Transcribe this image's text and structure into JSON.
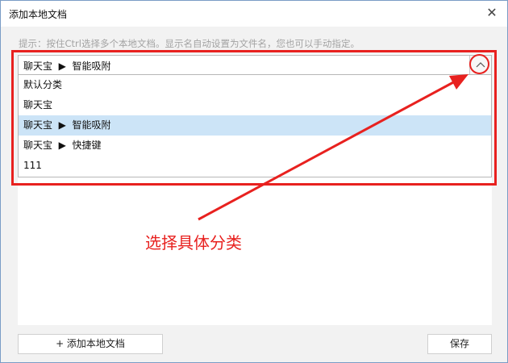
{
  "window": {
    "title": "添加本地文档",
    "close_icon": "close-icon"
  },
  "hint": "提示：按住Ctrl选择多个本地文档。显示名自动设置为文件名，您也可以手动指定。",
  "category_select": {
    "selected": "聊天宝  ▶  智能吸附",
    "toggle_icon": "chevron-up-icon",
    "options": [
      {
        "label": "默认分类",
        "selected": false
      },
      {
        "label": "聊天宝",
        "selected": false
      },
      {
        "label": "聊天宝  ▶  智能吸附",
        "selected": true
      },
      {
        "label": "聊天宝  ▶  快捷键",
        "selected": false
      },
      {
        "label": "111",
        "selected": false
      }
    ]
  },
  "annotation": {
    "text": "选择具体分类",
    "color": "#e8211f"
  },
  "footer": {
    "add_button": "+ 添加本地文档",
    "save_button": "保存"
  },
  "colors": {
    "selected_row": "#cce4f7",
    "highlight": "#e8211f"
  }
}
